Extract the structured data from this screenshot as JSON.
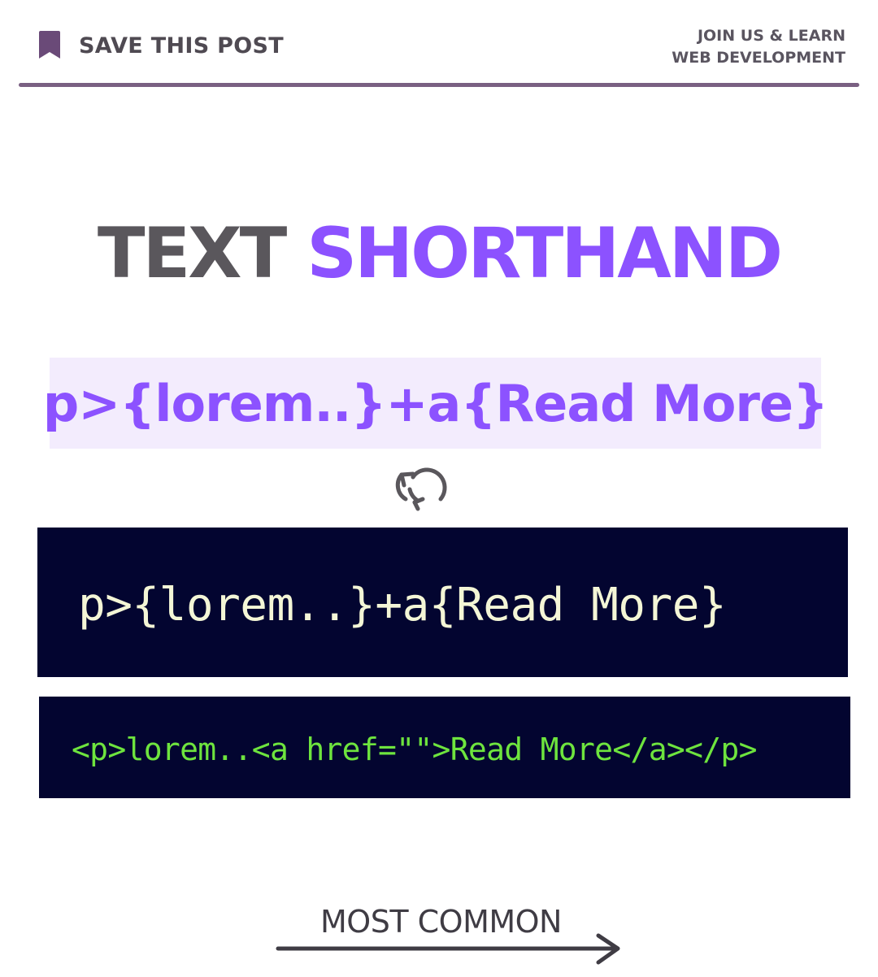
{
  "header": {
    "save_label": "SAVE THIS POST",
    "join_line1": "JOIN US & LEARN",
    "join_line2": "WEB DEVELOPMENT",
    "bookmark_icon": "bookmark-icon",
    "bookmark_color": "#6a4a78"
  },
  "title": {
    "word1": "TEXT",
    "word2": "SHORTHAND"
  },
  "shorthand": "p>{lorem..}+a{Read More}",
  "convert_icon": "convert-icon",
  "code": {
    "input": "p>{lorem..}+a{Read More}",
    "output": "<p>lorem..<a href=\"\">Read More</a></p>"
  },
  "footer": {
    "label": "MOST COMMON",
    "arrow_icon": "arrow-right-icon"
  },
  "colors": {
    "accent": "#8c52ff",
    "code_bg": "#030530",
    "code_output": "#6ee43e"
  }
}
